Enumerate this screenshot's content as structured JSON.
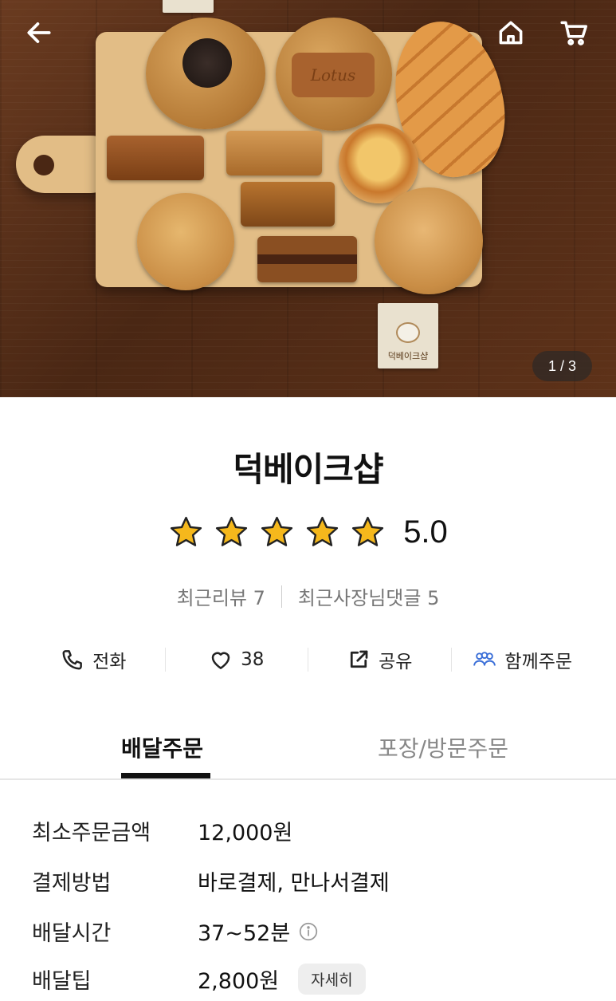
{
  "hero": {
    "page_indicator": "1 / 3",
    "cookie_logo_text": "Lotus",
    "card_text": "덕베이크샵",
    "buttons": {
      "back": "arrow-left-icon",
      "home": "home-icon",
      "cart": "cart-icon"
    }
  },
  "store": {
    "name": "덕베이크샵",
    "rating": "5.0",
    "rating_stars": 5,
    "recent_reviews": "최근리뷰 7",
    "recent_owner_replies": "최근사장님댓글 5"
  },
  "actions": [
    {
      "label": "전화",
      "icon": "phone-icon"
    },
    {
      "label": "38",
      "icon": "heart-icon"
    },
    {
      "label": "공유",
      "icon": "share-icon"
    },
    {
      "label": "함께주문",
      "icon": "group-icon"
    }
  ],
  "tabs": [
    {
      "label": "배달주문",
      "active": true
    },
    {
      "label": "포장/방문주문",
      "active": false
    }
  ],
  "info": {
    "min_order": {
      "label": "최소주문금액",
      "value": "12,000원"
    },
    "payment": {
      "label": "결제방법",
      "value": "바로결제, 만나서결제"
    },
    "delivery_time": {
      "label": "배달시간",
      "value": "37~52분"
    },
    "delivery_tip": {
      "label": "배달팁",
      "value": "2,800원",
      "button": "자세히"
    }
  },
  "colors": {
    "star": "#f5b81c",
    "group_icon": "#3b6fd8",
    "pager_bg": "#282828"
  }
}
